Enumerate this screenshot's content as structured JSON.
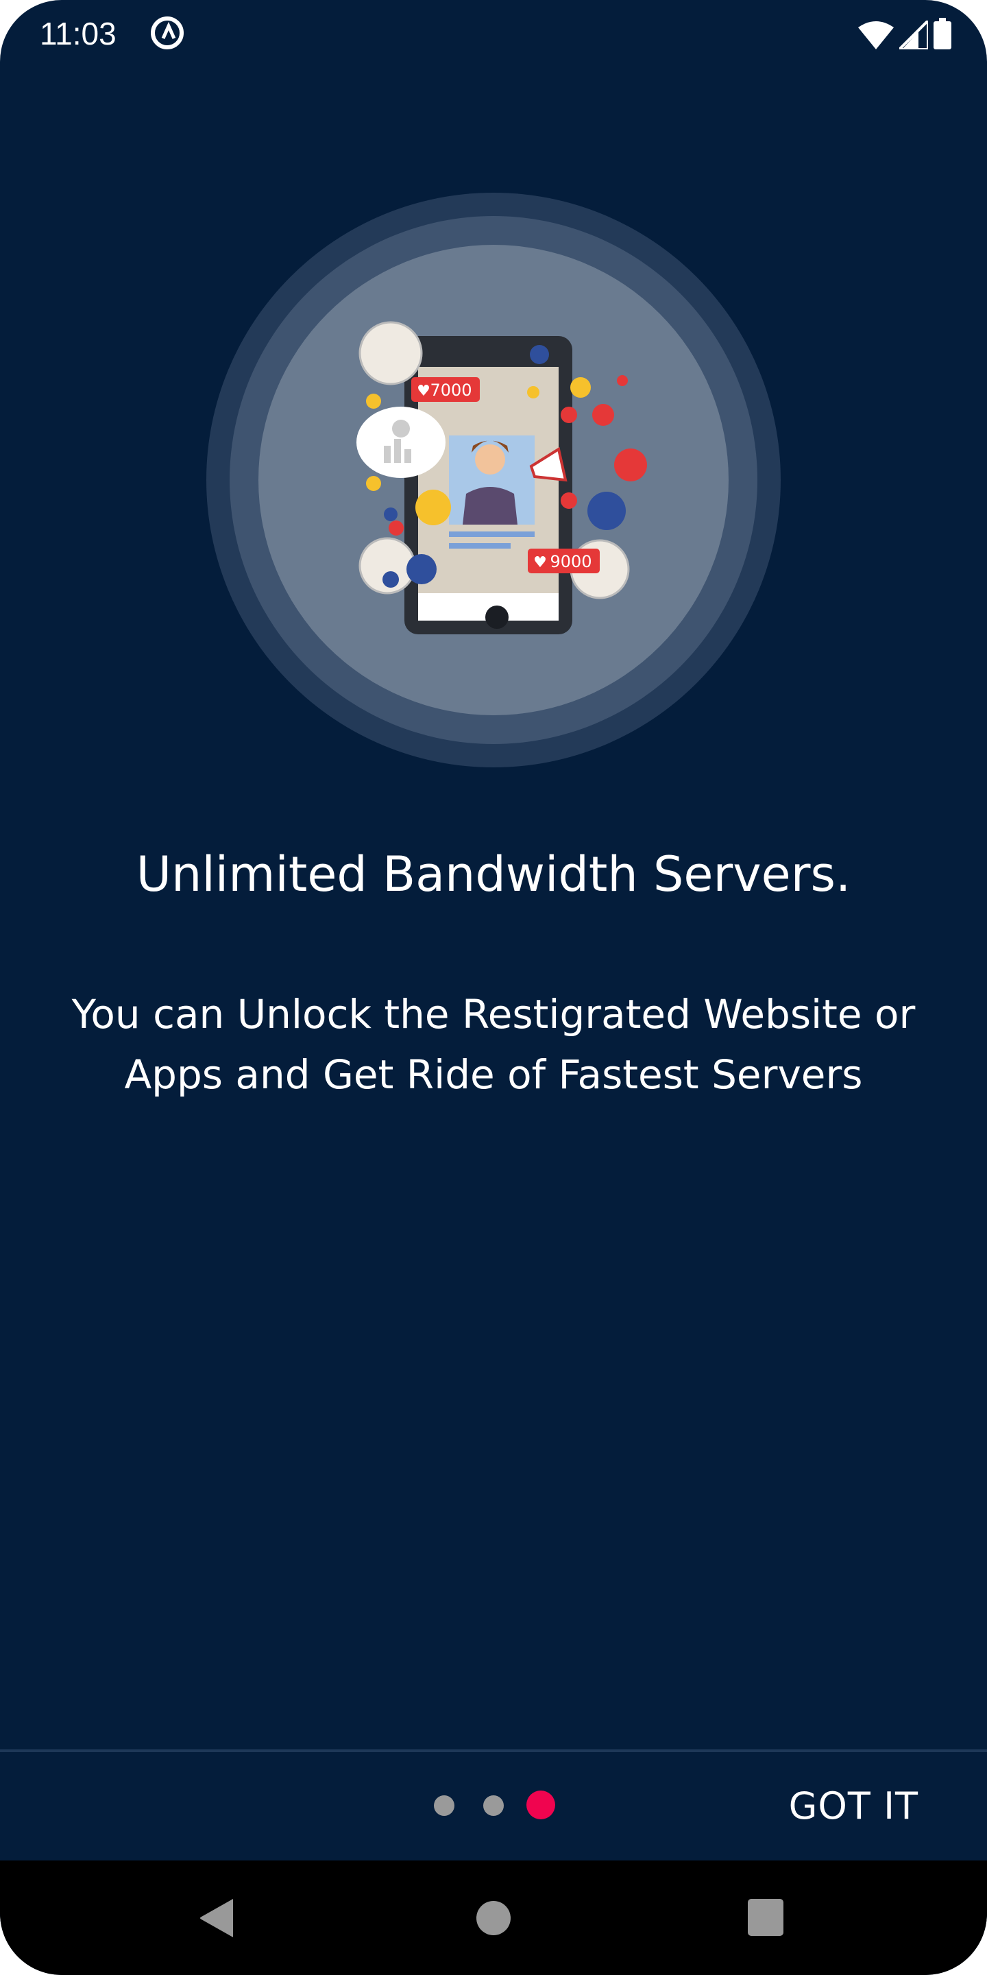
{
  "status_bar": {
    "time": "11:03",
    "icons": [
      "q-app-icon",
      "wifi-icon",
      "signal-icon",
      "battery-icon"
    ]
  },
  "onboarding": {
    "illustration": {
      "like_count_1": "7000",
      "like_count_2": "9000"
    },
    "title": "Unlimited Bandwidth Servers.",
    "subtitle": "You can Unlock the Restigrated Website or Apps and Get Ride of Fastest Servers"
  },
  "pager": {
    "total_pages": 3,
    "current_page": 3,
    "active_color": "#f0044f",
    "inactive_color": "#9a9a9a"
  },
  "footer": {
    "got_it_label": "GOT IT"
  },
  "nav_bar": {
    "icons": [
      "back-icon",
      "home-icon",
      "recents-icon"
    ]
  },
  "colors": {
    "background": "#041d3b",
    "nav_background": "#000000"
  }
}
